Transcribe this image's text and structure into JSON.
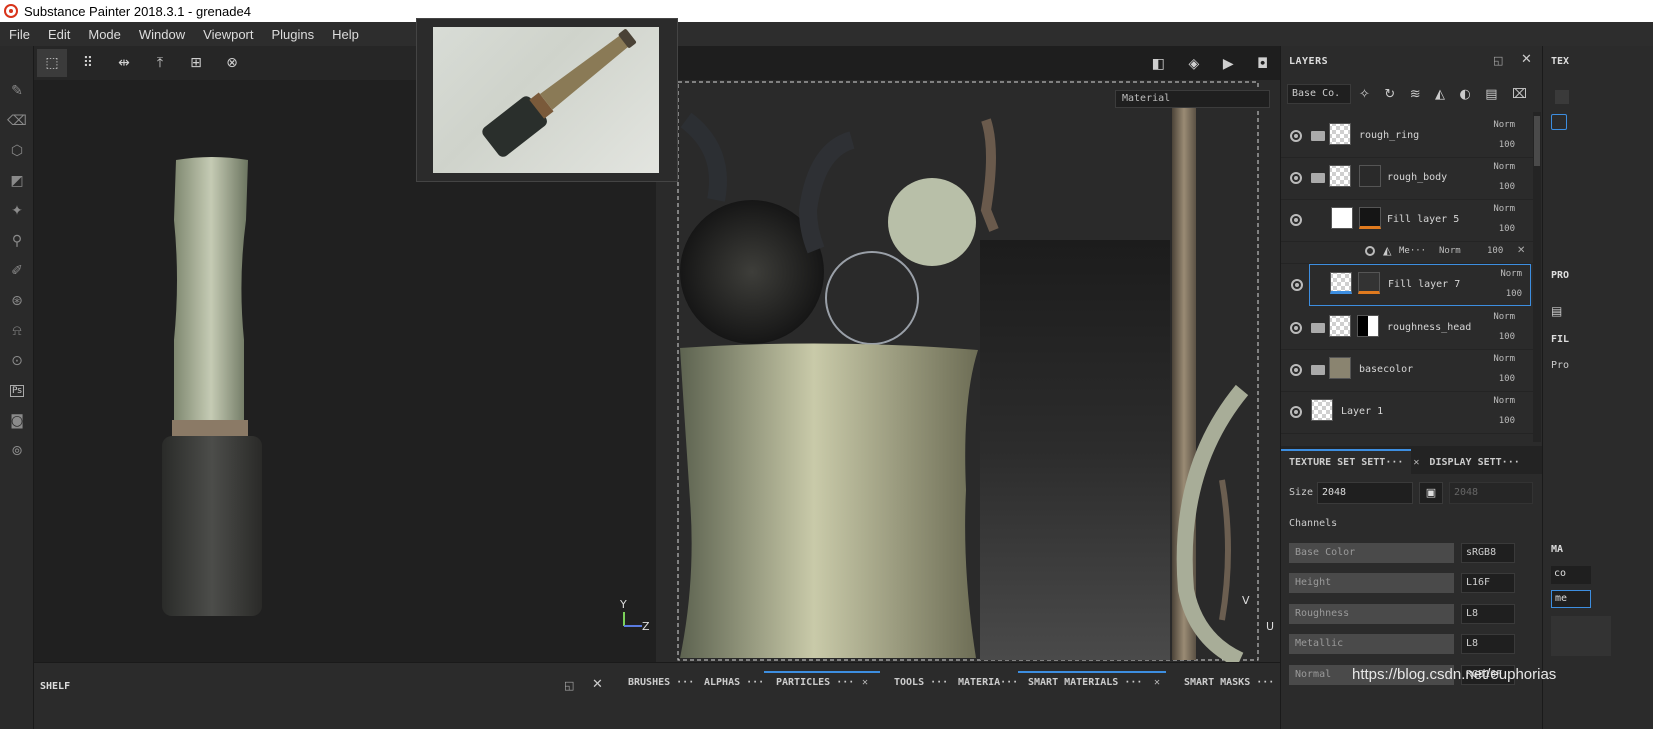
{
  "window": {
    "title": "Substance Painter 2018.3.1 - grenade4"
  },
  "menu": [
    "File",
    "Edit",
    "Mode",
    "Window",
    "Viewport",
    "Plugins",
    "Help"
  ],
  "viewport2d": {
    "material_select": "Material"
  },
  "axis_3d": {
    "y": "Y",
    "z": "Z"
  },
  "axis_2d": {
    "v": "V",
    "u": "U"
  },
  "layers_panel": {
    "title": "LAYERS",
    "channel_select": "Base Co.",
    "rows": [
      {
        "name": "rough_ring",
        "blend": "Norm",
        "opacity": "100"
      },
      {
        "name": "rough_body",
        "blend": "Norm",
        "opacity": "100"
      },
      {
        "name": "Fill layer 5",
        "blend": "Norm",
        "opacity": "100"
      },
      {
        "name": "Me···",
        "blend": "Norm",
        "opacity": "100"
      },
      {
        "name": "Fill layer 7",
        "blend": "Norm",
        "opacity": "100"
      },
      {
        "name": "roughness_head",
        "blend": "Norm",
        "opacity": "100"
      },
      {
        "name": "basecolor",
        "blend": "Norm",
        "opacity": "100"
      },
      {
        "name": "Layer 1",
        "blend": "Norm",
        "opacity": "100"
      }
    ]
  },
  "texture_set": {
    "tab_active": "TEXTURE SET SETT···",
    "tab_other": "DISPLAY SETT···",
    "size_label": "Size",
    "size_value": "2048",
    "size_value2": "2048",
    "channels_label": "Channels",
    "channels": [
      {
        "name": "Base Color",
        "format": "sRGB8"
      },
      {
        "name": "Height",
        "format": "L16F"
      },
      {
        "name": "Roughness",
        "format": "L8"
      },
      {
        "name": "Metallic",
        "format": "L8"
      },
      {
        "name": "Normal",
        "format": "RGB16F"
      }
    ]
  },
  "right_cut": {
    "tex": "TEX",
    "pro": "PRO",
    "fil": "FIL",
    "pro2": "Pro",
    "ma": "MA",
    "co": "co",
    "me": "me"
  },
  "shelf": {
    "title": "SHELF"
  },
  "bottom_tabs": [
    "BRUSHES ···",
    "ALPHAS ···",
    "PARTICLES ···",
    "TOOLS ···",
    "MATERIA···",
    "SMART MATERIALS ···",
    "SMART MASKS ···"
  ],
  "watermark": "https://blog.csdn.net/euphorias"
}
